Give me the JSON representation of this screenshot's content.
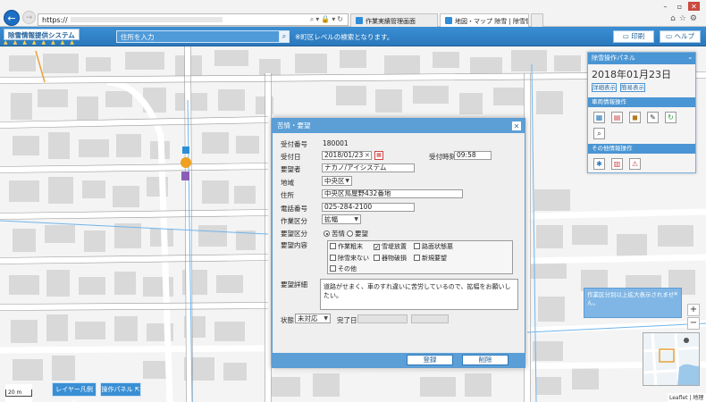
{
  "browser": {
    "url": "https://",
    "tabs": [
      {
        "label": "作業実績管理画面"
      },
      {
        "label": "地図・マップ 除雪 | 除雪情..."
      }
    ]
  },
  "header": {
    "app_title": "除雪情報提供システム",
    "address_placeholder": "住所を入力",
    "search_note": "※町区レベルの検索となります。",
    "print_label": "印刷",
    "help_label": "ヘルプ"
  },
  "side_panel": {
    "title": "除雪操作パネル",
    "date": "2018年01月23日",
    "detail_button": "詳細表示",
    "simple_button": "簡易表示",
    "section1_title": "車両情報操作",
    "section2_title": "その他情報操作",
    "section1_icons": [
      "list-icon",
      "table-icon",
      "truck-icon",
      "pencil-icon",
      "refresh-icon",
      "search-icon"
    ],
    "section2_icons": [
      "snow-icon",
      "report-icon",
      "warning-icon"
    ]
  },
  "dialog": {
    "title": "苦情・要望",
    "labels": {
      "request_no": "受付番号",
      "received_date": "受付日",
      "received_time": "受付時刻",
      "requester": "要望者",
      "area": "地域",
      "address": "住所",
      "phone": "電話番号",
      "work_type": "作業区分",
      "request_type": "要望区分",
      "content": "要望内容",
      "detail": "要望詳細",
      "status": "状態",
      "completion_date": "完了日"
    },
    "values": {
      "request_no": "180001",
      "received_date": "2018/01/23",
      "received_time": "09:58",
      "requester": "ナカノ/アイシステム",
      "area": "中央区",
      "address": "中央区鳥屋野432番地",
      "phone": "025-284-2100",
      "work_type": "拡幅",
      "status": "未対応",
      "detail": "道路がせまく、車のすれ違いに苦労しているので、拡幅をお願いしたい。"
    },
    "request_type_options": [
      {
        "label": "苦情",
        "checked": true
      },
      {
        "label": "要望",
        "checked": false
      }
    ],
    "content_options": [
      {
        "label": "作業粗末",
        "checked": false
      },
      {
        "label": "雪堤放置",
        "checked": true
      },
      {
        "label": "路面状態悪",
        "checked": false
      },
      {
        "label": "除雪来ない",
        "checked": false
      },
      {
        "label": "器物破損",
        "checked": false
      },
      {
        "label": "新規要望",
        "checked": false
      },
      {
        "label": "その他",
        "checked": false
      }
    ],
    "register_button": "登録",
    "delete_button": "削除"
  },
  "map": {
    "layer_legend_button": "レイヤー凡例",
    "control_panel_button": "操作パネル",
    "scale_label": "20 m",
    "notice": "作業区分別以上拡大表示されません。",
    "zoom_in": "+",
    "zoom_out": "−",
    "attribution": "Leaflet | 地理院"
  },
  "colors": {
    "accent": "#3a8fd4",
    "dialog_header": "#5b9fd6",
    "close_button": "#c94a3f"
  }
}
